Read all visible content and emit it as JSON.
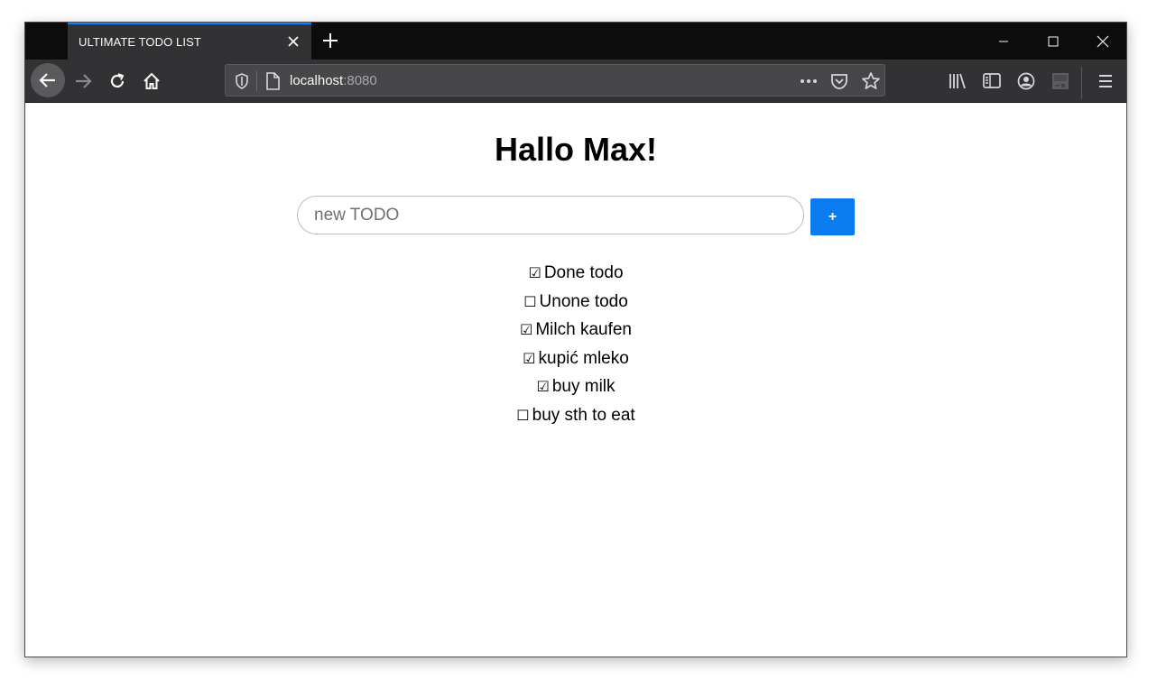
{
  "browser": {
    "tab_title": "ULTIMATE TODO LIST",
    "url_host": "localhost",
    "url_port": ":8080"
  },
  "page": {
    "greeting": "Hallo Max!",
    "input_placeholder": "new TODO",
    "add_label": "+",
    "todos": [
      {
        "checkbox": "☑",
        "text": "Done todo",
        "done": true
      },
      {
        "checkbox": "☐",
        "text": "Unone todo",
        "done": false
      },
      {
        "checkbox": "☑",
        "text": "Milch kaufen",
        "done": true
      },
      {
        "checkbox": "☑",
        "text": "kupić mleko",
        "done": true
      },
      {
        "checkbox": "☑",
        "text": "buy milk",
        "done": true
      },
      {
        "checkbox": "☐",
        "text": "buy sth to eat",
        "done": false
      }
    ]
  },
  "colors": {
    "accent": "#0a84ff",
    "add_button": "#0a7cf0",
    "toolbar": "#323234",
    "tabstrip": "#0c0c0d"
  }
}
